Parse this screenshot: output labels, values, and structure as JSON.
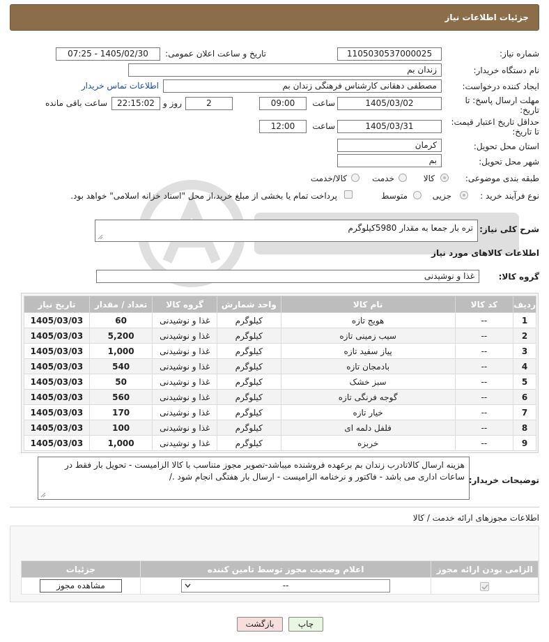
{
  "header": {
    "title": "جزئیات اطلاعات نیاز"
  },
  "form": {
    "need_number_label": "شماره نیاز:",
    "need_number": "1105030537000025",
    "announce_label": "تاریخ و ساعت اعلان عمومی:",
    "announce_value": "1405/02/30 - 07:25",
    "buyer_org_label": "نام دستگاه خریدار:",
    "buyer_org": "زندان بم",
    "creator_label": "ایجاد کننده درخواست:",
    "creator": "مصطفی دهقانی کارشناس فرهنگی زندان بم",
    "contact_link": "اطلاعات تماس خریدار",
    "deadline_label_1": "مهلت ارسال پاسخ: تا",
    "deadline_label_2": "تاریخ:",
    "deadline_date": "1405/03/02",
    "time_word": "ساعت",
    "deadline_time": "09:00",
    "days_value": "2",
    "days_word": "روز و",
    "remaining_time": "22:15:02",
    "remaining_word": "ساعت باقی مانده",
    "price_label_1": "حداقل تاریخ اعتبار قیمت:",
    "price_label_2": "تا تاریخ:",
    "price_date": "1405/03/31",
    "price_time": "12:00",
    "province_label": "استان محل تحویل:",
    "province": "کرمان",
    "city_label": "شهر محل تحویل:",
    "city": "بم",
    "category_label": "طبقه بندی موضوعی:",
    "cat_goods": "کالا",
    "cat_service": "خدمت",
    "cat_both": "کالا/خدمت",
    "process_label": "نوع فرآیند خرید :",
    "proc_partial": "جزیی",
    "proc_medium": "متوسط",
    "payment_note": "پرداخت تمام یا بخشی از مبلغ خرید،از محل \"اسناد خزانه اسلامی\" خواهد بود."
  },
  "description": {
    "label": "شرح کلی نیاز:",
    "text": "تره بار جمعا به مقدار 5980کیلوگرم"
  },
  "goods": {
    "section_title": "اطلاعات کالاهای مورد نیاز",
    "group_label": "گروه کالا:",
    "group_value": "غذا و نوشیدنی",
    "headers": {
      "row": "ردیف",
      "code": "کد کالا",
      "name": "نام کالا",
      "unit": "واحد شمارش",
      "group": "گروه کالا",
      "qty": "تعداد / مقدار",
      "date": "تاریخ نیاز"
    },
    "rows": [
      {
        "row": "1",
        "code": "--",
        "name": "هویج تازه",
        "unit": "کیلوگرم",
        "group": "غذا و نوشیدنی",
        "qty": "60",
        "date": "1405/03/03"
      },
      {
        "row": "2",
        "code": "--",
        "name": "سیب زمینی تازه",
        "unit": "کیلوگرم",
        "group": "غذا و نوشیدنی",
        "qty": "5,200",
        "date": "1405/03/03"
      },
      {
        "row": "3",
        "code": "--",
        "name": "پیاز سفید تازه",
        "unit": "کیلوگرم",
        "group": "غذا و نوشیدنی",
        "qty": "1,000",
        "date": "1405/03/03"
      },
      {
        "row": "4",
        "code": "--",
        "name": "بادمجان تازه",
        "unit": "کیلوگرم",
        "group": "غذا و نوشیدنی",
        "qty": "540",
        "date": "1405/03/03"
      },
      {
        "row": "5",
        "code": "--",
        "name": "سبز خشک",
        "unit": "کیلوگرم",
        "group": "غذا و نوشیدنی",
        "qty": "50",
        "date": "1405/03/03"
      },
      {
        "row": "6",
        "code": "--",
        "name": "گوجه فرنگی تازه",
        "unit": "کیلوگرم",
        "group": "غذا و نوشیدنی",
        "qty": "560",
        "date": "1405/03/03"
      },
      {
        "row": "7",
        "code": "--",
        "name": "خیار تازه",
        "unit": "کیلوگرم",
        "group": "غذا و نوشیدنی",
        "qty": "170",
        "date": "1405/03/03"
      },
      {
        "row": "8",
        "code": "--",
        "name": "فلفل دلمه ای",
        "unit": "کیلوگرم",
        "group": "غذا و نوشیدنی",
        "qty": "100",
        "date": "1405/03/03"
      },
      {
        "row": "9",
        "code": "--",
        "name": "خربزه",
        "unit": "کیلوگرم",
        "group": "غذا و نوشیدنی",
        "qty": "1,000",
        "date": "1405/03/03"
      }
    ]
  },
  "buyer_notes": {
    "label": "توضیحات خریدار:",
    "text": "هزینه ارسال کالاتادرب زندان بم برعهده فروشنده میباشد-تصویر مجوز متناسب با کالا الزامیست - تحویل بار فقط در ساعات اداری می باشد - فاکتور و نرخنامه الزامیست - ارسال بار هفتگی انجام شود ./"
  },
  "licenses": {
    "section_title": "اطلاعات مجوزهای ارائه خدمت / کالا",
    "headers": {
      "required": "الزامی بودن ارائه مجوز",
      "status": "اعلام وضعیت مجوز توسط تامین کننده",
      "details": "جزئیات"
    },
    "select_value": "--",
    "view_button": "مشاهده مجوز"
  },
  "actions": {
    "print": "چاپ",
    "back": "بازگشت"
  },
  "colors": {
    "header_bg": "#8b6d4a",
    "table_header": "#bdbdbd",
    "link": "#1a4fa0",
    "back_button": "#f7dede",
    "print_button": "#e8f6e2"
  }
}
